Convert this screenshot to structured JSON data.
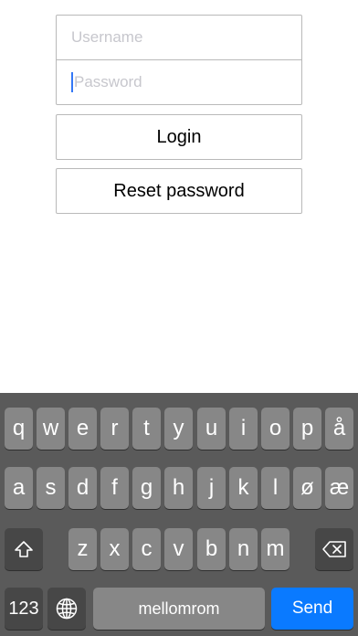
{
  "form": {
    "username_placeholder": "Username",
    "password_placeholder": "Password",
    "login_label": "Login",
    "reset_label": "Reset password"
  },
  "keyboard": {
    "row1": [
      "q",
      "w",
      "e",
      "r",
      "t",
      "y",
      "u",
      "i",
      "o",
      "p",
      "å"
    ],
    "row2": [
      "a",
      "s",
      "d",
      "f",
      "g",
      "h",
      "j",
      "k",
      "l",
      "ø",
      "æ"
    ],
    "row3": [
      "z",
      "x",
      "c",
      "v",
      "b",
      "n",
      "m"
    ],
    "numbers_label": "123",
    "space_label": "mellomrom",
    "send_label": "Send",
    "icons": {
      "shift": "shift-icon",
      "delete": "backspace-icon",
      "globe": "globe-icon"
    }
  },
  "colors": {
    "keyboard_bg": "#5a5a5a",
    "key_bg": "#878787",
    "function_key_bg": "#474747",
    "send_bg": "#0a7aff",
    "caret": "#3478f6"
  }
}
